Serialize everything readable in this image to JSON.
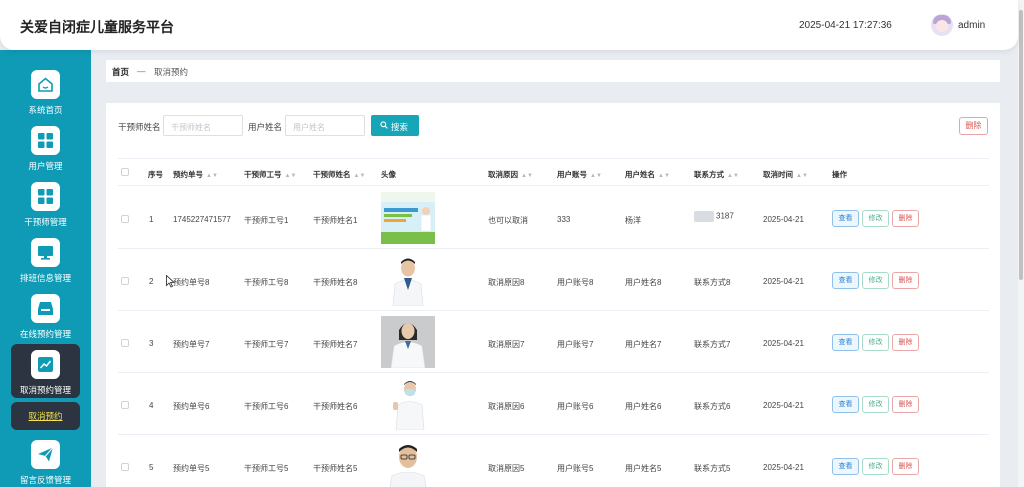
{
  "header": {
    "title": "关爱自闭症儿童服务平台",
    "datetime": "2025-04-21 17:27:36",
    "username": "admin"
  },
  "sidebar": {
    "items": [
      {
        "label": "系统首页",
        "icon": "home-icon"
      },
      {
        "label": "用户管理",
        "icon": "grid-icon"
      },
      {
        "label": "干预师管理",
        "icon": "grid-icon"
      },
      {
        "label": "排班信息管理",
        "icon": "monitor-icon"
      },
      {
        "label": "在线预约管理",
        "icon": "inbox-icon"
      },
      {
        "label": "取消预约管理",
        "icon": "chart-icon"
      },
      {
        "label": "留言反馈管理",
        "icon": "send-icon"
      }
    ],
    "sub_item": "取消预约"
  },
  "breadcrumb": {
    "home": "首页",
    "separator": "—",
    "current": "取消预约"
  },
  "filters": {
    "therapist_label": "干预师姓名",
    "therapist_placeholder": "干预师姓名",
    "user_label": "用户姓名",
    "user_placeholder": "用户姓名",
    "search_button": "搜索",
    "delete_button": "删除"
  },
  "table": {
    "columns": [
      "序号",
      "预约单号",
      "干预师工号",
      "干预师姓名",
      "头像",
      "取消原因",
      "用户账号",
      "用户姓名",
      "联系方式",
      "取消时间",
      "操作"
    ],
    "actions": {
      "view": "查看",
      "edit": "修改",
      "delete": "删除"
    },
    "rows": [
      {
        "index": "1",
        "order_no": "1745227471577",
        "therapist_id": "干预师工号1",
        "therapist_name": "干预师姓名1",
        "reason": "也可以取消",
        "account": "333",
        "user_name": "杨洋",
        "contact": "3187",
        "cancel_time": "2025-04-21",
        "photo": "banner"
      },
      {
        "index": "2",
        "order_no": "预约单号8",
        "therapist_id": "干预师工号8",
        "therapist_name": "干预师姓名8",
        "reason": "取消原因8",
        "account": "用户账号8",
        "user_name": "用户姓名8",
        "contact": "联系方式8",
        "cancel_time": "2025-04-21",
        "photo": "doctor-male"
      },
      {
        "index": "3",
        "order_no": "预约单号7",
        "therapist_id": "干预师工号7",
        "therapist_name": "干预师姓名7",
        "reason": "取消原因7",
        "account": "用户账号7",
        "user_name": "用户姓名7",
        "contact": "联系方式7",
        "cancel_time": "2025-04-21",
        "photo": "doctor-female"
      },
      {
        "index": "4",
        "order_no": "预约单号6",
        "therapist_id": "干预师工号6",
        "therapist_name": "干预师姓名6",
        "reason": "取消原因6",
        "account": "用户账号6",
        "user_name": "用户姓名6",
        "contact": "联系方式6",
        "cancel_time": "2025-04-21",
        "photo": "doctor-masked"
      },
      {
        "index": "5",
        "order_no": "预约单号5",
        "therapist_id": "干预师工号5",
        "therapist_name": "干预师姓名5",
        "reason": "取消原因5",
        "account": "用户账号5",
        "user_name": "用户姓名5",
        "contact": "联系方式5",
        "cancel_time": "2025-04-21",
        "photo": "doctor-glasses"
      }
    ]
  },
  "colors": {
    "sidebar": "#0f9bb5",
    "active": "#2b3440",
    "primary": "#17a5b8",
    "danger": "#d9534f"
  }
}
